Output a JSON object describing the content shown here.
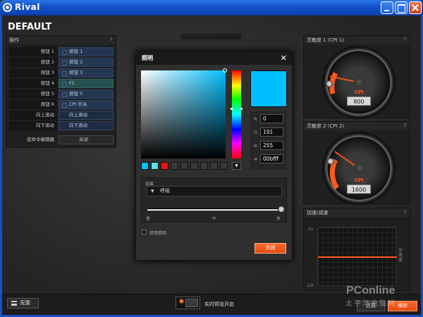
{
  "window": {
    "title": "Rival"
  },
  "profile": {
    "name": "DEFAULT"
  },
  "buttons_panel": {
    "title": "操作",
    "help": "?",
    "rows": [
      {
        "label": "按钮 1",
        "value": "按钮 1",
        "style": "blue"
      },
      {
        "label": "按钮 2",
        "value": "按钮 2",
        "style": "blue"
      },
      {
        "label": "按钮 3",
        "value": "按钮 3",
        "style": "blue"
      },
      {
        "label": "按钮 4",
        "value": "F5",
        "style": "teal"
      },
      {
        "label": "按钮 5",
        "value": "按钮 5",
        "style": "blue"
      },
      {
        "label": "按钮 6",
        "value": "CPI 开关",
        "style": "blue"
      },
      {
        "label": "向上滚动",
        "value": "向上滚动",
        "style": "dark"
      },
      {
        "label": "向下滚动",
        "value": "向下滚动",
        "style": "dark"
      }
    ],
    "macro": {
      "label": "宏命令编辑器",
      "value": "关闭"
    }
  },
  "cpi1": {
    "title": "灵敏度 1 (CPI 1)",
    "unit": "CPI",
    "value": "800",
    "help": "?"
  },
  "cpi2": {
    "title": "灵敏度 2 (CPI 2)",
    "unit": "CPI",
    "value": "1600",
    "help": "?"
  },
  "accel": {
    "title": "加速/减速",
    "top_label": "2x",
    "bottom_label": "1/2",
    "side_label": "全速度",
    "help": "?"
  },
  "dialog": {
    "title": "照明",
    "close_glyph": "✕",
    "color_hex": "#00bfff",
    "r": "0",
    "g": "191",
    "b": "255",
    "hex": "00bfff",
    "labels": {
      "r": "R",
      "g": "G",
      "b": "B",
      "hex": "#"
    },
    "presets": [
      "#00bfff",
      "#5ae0e8",
      "#ee1111",
      "#3a3a3a",
      "#3a3a3a",
      "#3a3a3a",
      "#3a3a3a",
      "#3a3a3a",
      "#3a3a3a"
    ],
    "effect_label": "效果",
    "effect_value": "呼吸",
    "speed_slow": "慢",
    "speed_mid": "中",
    "speed_fast": "快",
    "speed_value": 1.0,
    "disable_label": "禁用照明",
    "ok_label": "关闭"
  },
  "bottom": {
    "config_label": "配置",
    "live_label": "实时预览开启",
    "revert_label": "还原",
    "save_label": "保存"
  },
  "watermark": {
    "brand": "PConline",
    "sub": "太平洋电脑网"
  },
  "colors": {
    "accent": "#ff5a1e",
    "selected": "#00bfff",
    "titlebar": "#1453c9"
  }
}
